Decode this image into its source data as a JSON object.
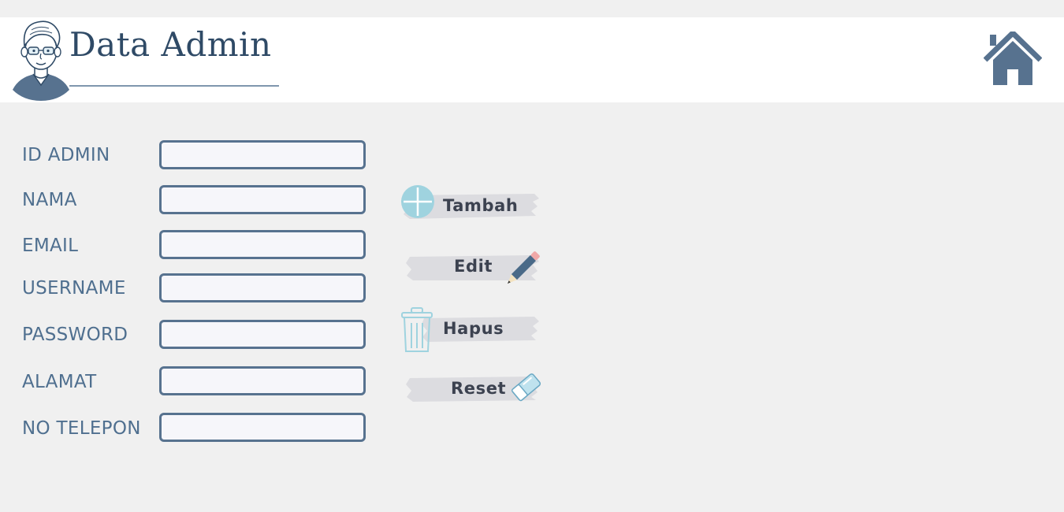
{
  "header": {
    "title": "Data Admin",
    "home_icon": "home-icon",
    "avatar_icon": "admin-avatar-icon"
  },
  "form": {
    "fields": [
      {
        "label": "ID ADMIN",
        "value": ""
      },
      {
        "label": "NAMA",
        "value": ""
      },
      {
        "label": "EMAIL",
        "value": ""
      },
      {
        "label": "USERNAME",
        "value": ""
      },
      {
        "label": "PASSWORD",
        "value": ""
      },
      {
        "label": "ALAMAT",
        "value": ""
      },
      {
        "label": "NO TELEPON",
        "value": ""
      }
    ]
  },
  "actions": {
    "add": {
      "label": "Tambah",
      "icon": "plus-circle-icon"
    },
    "edit": {
      "label": "Edit",
      "icon": "pencil-icon"
    },
    "delete": {
      "label": "Hapus",
      "icon": "trash-icon"
    },
    "reset": {
      "label": "Reset",
      "icon": "eraser-icon"
    }
  },
  "colors": {
    "primary": "#57728f",
    "title": "#2f4a66",
    "label": "#4f6f8f",
    "accent": "#9fd3df",
    "brush": "#dcdce0",
    "background": "#f0f0f0"
  }
}
